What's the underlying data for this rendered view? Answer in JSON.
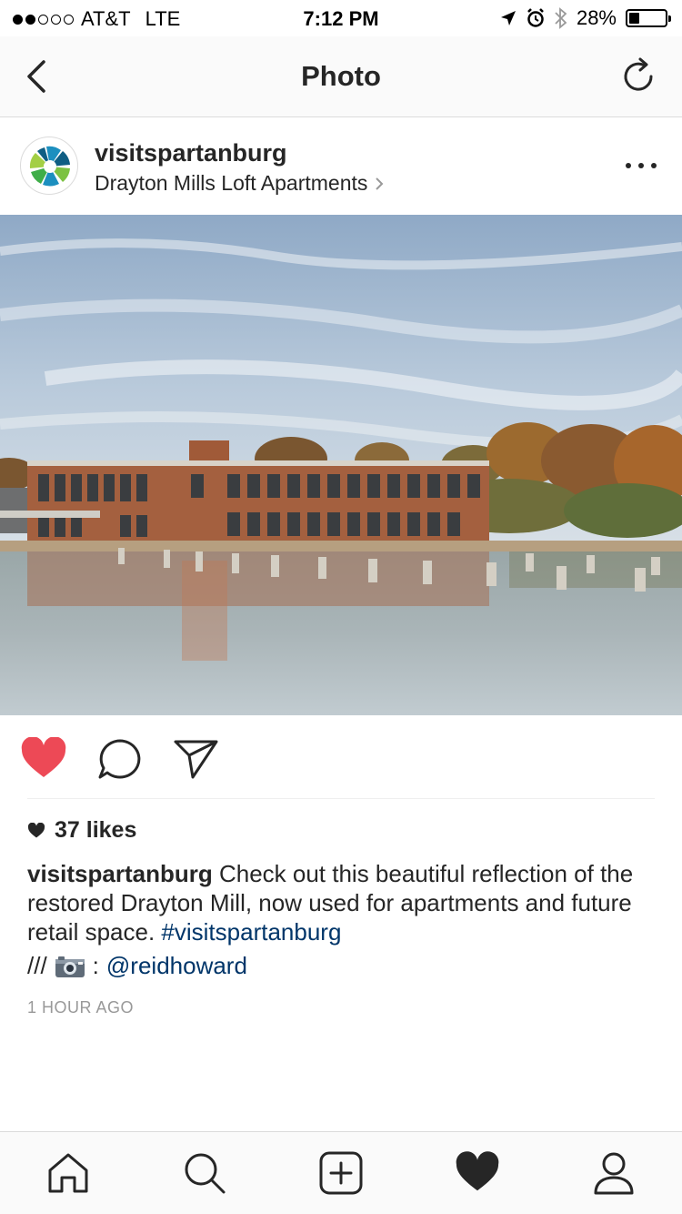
{
  "status_bar": {
    "carrier": "AT&T",
    "network": "LTE",
    "time": "7:12 PM",
    "battery": "28%",
    "battery_level": 0.28,
    "signal_bars": 2
  },
  "nav": {
    "title": "Photo"
  },
  "post": {
    "username": "visitspartanburg",
    "location": "Drayton Mills Loft Apartments",
    "likes": "37 likes",
    "caption_username": "visitspartanburg",
    "caption_text": "Check out this beautiful reflection of the restored Drayton Mill, now used for apartments and future retail space.",
    "hashtag": "#visitspartanburg",
    "credit_prefix": "///",
    "credit_colon": ":",
    "mention": "@reidhoward",
    "timestamp": "1 HOUR AGO",
    "liked": true
  },
  "colors": {
    "like_red": "#ed4956",
    "link_blue": "#003569",
    "text": "#262626",
    "muted": "#999999"
  },
  "icons": {
    "back": "chevron-left-icon",
    "refresh": "refresh-icon",
    "more": "more-dots-icon",
    "like": "heart-icon",
    "comment": "comment-icon",
    "share": "paper-plane-icon",
    "camera": "camera-icon",
    "home": "home-icon",
    "search": "search-icon",
    "add": "add-post-icon",
    "activity": "heart-activity-icon",
    "profile": "profile-icon"
  }
}
